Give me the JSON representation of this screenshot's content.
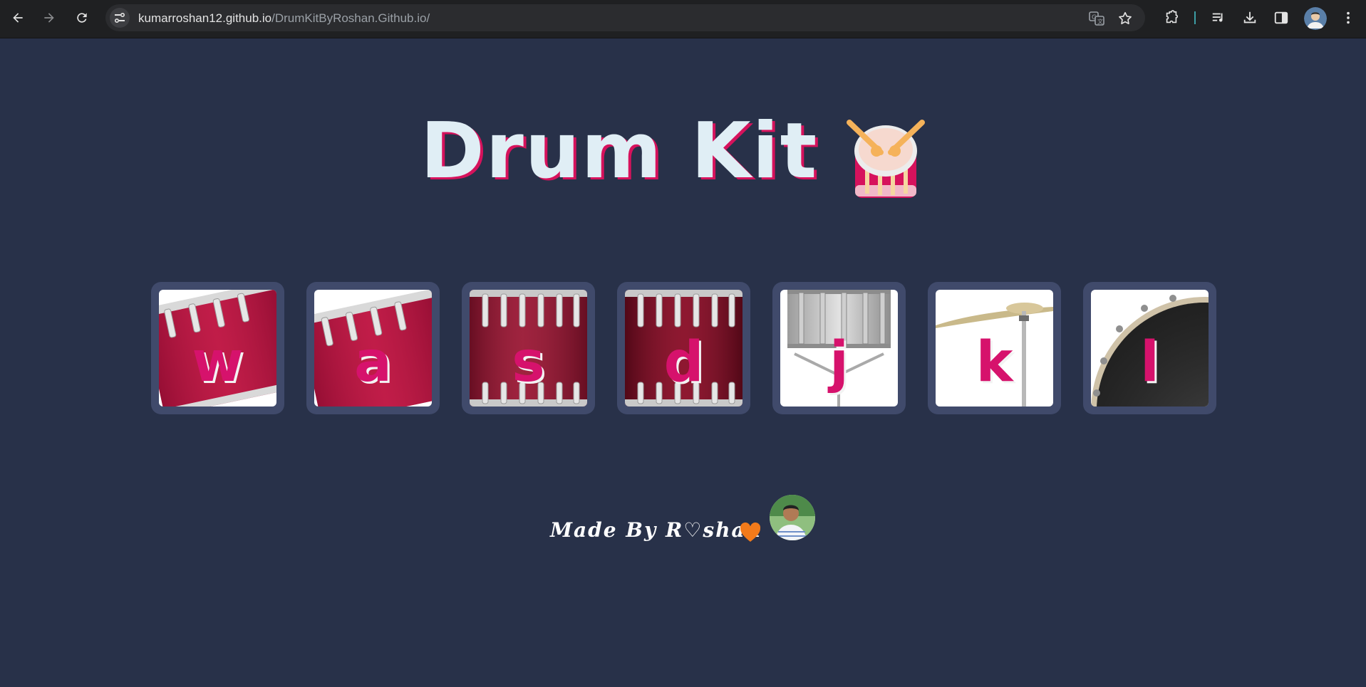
{
  "browser": {
    "url_host": "kumarroshan12.github.io",
    "url_path": "/DrumKitByRoshan.Github.io/"
  },
  "page": {
    "title": "Drum Kit",
    "footer_text": "Made By R♡shan"
  },
  "drums": [
    {
      "key": "w",
      "kind": "tom-red-tilted"
    },
    {
      "key": "a",
      "kind": "tom-red-tilted"
    },
    {
      "key": "s",
      "kind": "snare-red"
    },
    {
      "key": "d",
      "kind": "snare-red"
    },
    {
      "key": "j",
      "kind": "snare-silver"
    },
    {
      "key": "k",
      "kind": "cymbal"
    },
    {
      "key": "l",
      "kind": "bass-drum"
    }
  ],
  "colors": {
    "background": "#283149",
    "drum_tile": "#404a6b",
    "key_letter": "#d6126c",
    "title_shadow": "#d6125c"
  }
}
